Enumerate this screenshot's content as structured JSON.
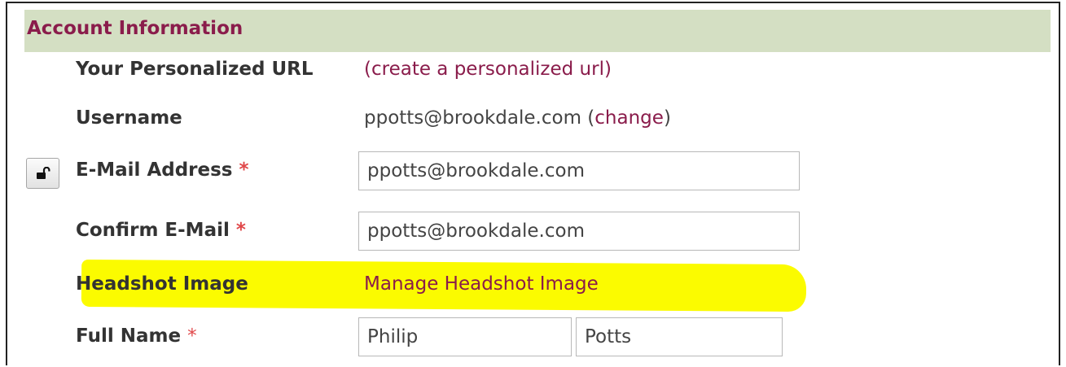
{
  "section": {
    "title": "Account Information"
  },
  "required_mark": "*",
  "personalized_url": {
    "label": "Your Personalized URL",
    "link": "(create a personalized url)"
  },
  "username": {
    "label": "Username",
    "value": "ppotts@brookdale.com",
    "open_paren": " (",
    "change_link": "change",
    "close_paren": ")"
  },
  "email": {
    "label": "E-Mail Address",
    "value": "ppotts@brookdale.com",
    "lock_icon": "unlock-icon"
  },
  "confirm_email": {
    "label": "Confirm E-Mail",
    "value": "ppotts@brookdale.com"
  },
  "headshot": {
    "label": "Headshot Image",
    "link": "Manage Headshot Image",
    "highlight_color": "#fbfb00"
  },
  "full_name": {
    "label": "Full Name",
    "first": "Philip",
    "last": "Potts"
  },
  "colors": {
    "header_bg": "#d4dfc3",
    "header_text": "#8a1c4b",
    "link": "#8a1c4b",
    "required": "#e0484a"
  }
}
